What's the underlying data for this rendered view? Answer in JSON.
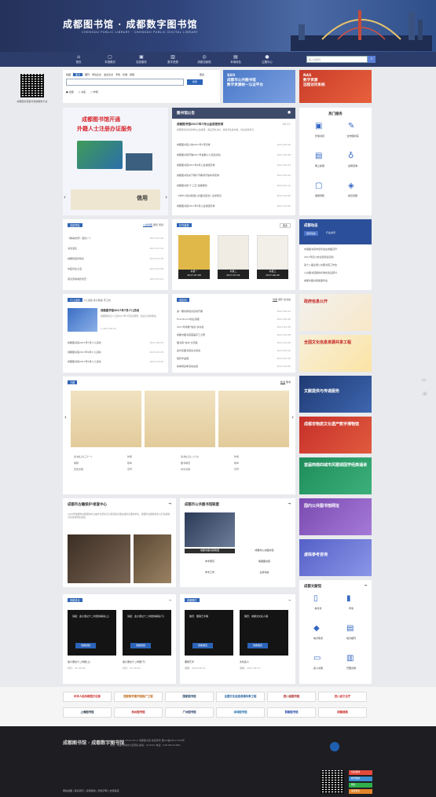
{
  "header": {
    "logo": "成都图书馆 · 成都数字图书馆",
    "logo_sub": "CHENGDU PUBLIC LIBRARY · CHENGDU PUBLIC DIGITAL LIBRARY"
  },
  "nav": [
    {
      "icon": "⌂",
      "label": "首页"
    },
    {
      "icon": "▢",
      "label": "本馆概况"
    },
    {
      "icon": "▣",
      "label": "信息服务"
    },
    {
      "icon": "▥",
      "label": "数字资源"
    },
    {
      "icon": "◎",
      "label": "成都文献馆"
    },
    {
      "icon": "▤",
      "label": "本地特色"
    },
    {
      "icon": "●",
      "label": "主题中心"
    }
  ],
  "search": {
    "placeholder": "输入关键词",
    "button": "搜索"
  },
  "left": {
    "qr_caption": "成都图书馆官方微信服务平台"
  },
  "searchbox": {
    "tabs": [
      "馆藏",
      "图书",
      "期刊",
      "学位论文",
      "会议论文",
      "专利",
      "标准",
      "视频"
    ],
    "tab_active": "图书",
    "more": "更多",
    "options": [
      "全部",
      "书名",
      "作者"
    ],
    "button": "搜索"
  },
  "ads": {
    "sso": "SSO\n成都市公共图书馆\n数字资源统一认证平台",
    "ras": "RAS\n数字资源\n远程访问系统"
  },
  "banner": {
    "line1": "成都图书馆开通",
    "line2": "外籍人士注册办证服务",
    "caption": "信用"
  },
  "notice": {
    "title": "图书馆公告",
    "headline": "成都图书馆2017年7月公益讲座安排",
    "date": "06-21",
    "desc": "成都图书馆每月举办公益讲座，涵盖历史文化、健康养生等内容，欢迎读者参与。",
    "items": [
      [
        "成都图书馆公告2017年7月安排",
        "2017-06-20"
      ],
      [
        "成都图书馆开展2017年暑期少儿阅读活动",
        "2017-05-26"
      ],
      [
        "成都图书馆2017年6月公益讲座安排",
        "2017-05-23"
      ],
      [
        "成都图书馆关于端午节期间开放时间安排",
        "2017-05-22"
      ],
      [
        "成都图书馆\"十三五\"发展规划",
        "2017-05-12"
      ],
      [
        "《中华人民共和国公共图书馆法》征求意见",
        "2017-05-05"
      ],
      [
        "成都图书馆2017年5月公益讲座安排",
        "2017-04-25"
      ]
    ]
  },
  "hot": {
    "title": "热门服务",
    "items": [
      "外借书目",
      "全市图书馆",
      "网上续借",
      "读者咨询",
      "借阅须知",
      "常见问题"
    ]
  },
  "preview": {
    "title": "讲座预告",
    "tabs": [
      "公益讲座",
      "展览",
      "培训"
    ],
    "items": [
      [
        "《聊斋志异》漫谈(一)",
        "2017-07-29"
      ],
      [
        "书法漫谈",
        "2017-07-22"
      ],
      [
        "成都民俗风情谈",
        "2017-07-15"
      ],
      [
        "中医养生之道",
        "2017-07-08"
      ],
      [
        "英文原版电影欣赏",
        "2017-07-01"
      ]
    ]
  },
  "books": {
    "title": "好书推荐",
    "more": "更多",
    "items": [
      {
        "t": "书目一",
        "d": "2017-07-08"
      },
      {
        "t": "书目二",
        "d": "2017-07-01"
      },
      {
        "t": "书目三",
        "d": "2017-06-30"
      }
    ]
  },
  "news": {
    "title": "成都动态",
    "tabs": [
      "馆务动态",
      "行业资讯"
    ],
    "items": [
      "中国图书馆学会年会在成都召开",
      "2017年四川省全民阅读活动",
      "第十八届全国公共图书馆工作会",
      "公共图书馆服务标准化建设研讨",
      "成都市图书馆联盟年会"
    ]
  },
  "kids": {
    "title": "少儿活动",
    "tabs": [
      "少儿活动",
      "亲子阅读",
      "手工坊"
    ],
    "headline": "成都图书馆2017年7月少儿活动",
    "desc": "成都图书馆少儿部2017年7月活动预告，欢迎小读者参加。",
    "date": "2017-06-23",
    "items": [
      [
        "成都图书馆2017年7月少儿活动",
        "2017-06-23"
      ],
      [
        "成都图书馆2017年6月少儿活动",
        "2017-05-25"
      ],
      [
        "成都图书馆2017年5月少儿活动",
        "2017-04-20"
      ]
    ]
  },
  "create": {
    "title": "创空间",
    "tabs": [
      "创客",
      "摄影",
      "读书会"
    ],
    "items": [
      [
        "第一期创客培训活动开展",
        "2017-06-23"
      ],
      [
        "First Round创业讲座",
        "2017-06-20"
      ],
      [
        "2017年成都\"悦读\"读书会",
        "2017-05-30"
      ],
      [
        "成都市图书馆首届手工大赛",
        "2017-05-28"
      ],
      [
        "图书馆\"读书\"交流会",
        "2017-05-20"
      ],
      [
        "金牛区图书馆读书活动",
        "2017-05-15"
      ],
      [
        "摄影作品展",
        "2017-05-10"
      ],
      [
        "春季阅读季活动总结",
        "2017-05-05"
      ]
    ]
  },
  "rightBanners": [
    "政府信息公开",
    "全国文化信息资源共享工程",
    "文献提供与传递服务",
    "成都非物质文化遗产数字博物馆",
    "首届西南四城市风雅颂国学经典诵读",
    "国内公共图书馆网址",
    "虚拟参考咨询"
  ],
  "guji": {
    "title": "古籍",
    "tabs": [
      "新书",
      "借书"
    ],
    "items": [
      [
        "读书札记(三十一)",
        "作者",
        "读书札记(二十九)",
        "作者"
      ],
      [
        "编辑",
        "版本",
        "图书编目",
        "版本"
      ],
      [
        "历史文献",
        "序号",
        "中文文献",
        "序号"
      ]
    ]
  },
  "protect": {
    "title": "成都市古籍保护/修复中心",
    "text": "2016年成都市古籍保护中心被文化部命名为第四批全国古籍重点保护单位，成都市古籍修复中心已具备较为完善的修复设施。",
    "more": "→"
  },
  "alliance": {
    "title": "成都市公共图书馆联盟",
    "more": "→",
    "tabs": [
      "成都市图书馆联盟",
      "成都市公共图书馆"
    ],
    "cells": [
      "学术研究",
      "联盟图书馆",
      "学术工作",
      "业务动态"
    ]
  },
  "localDocs": {
    "title": "成都文献馆",
    "more": "→",
    "items": [
      "地方志",
      "年鉴",
      "地方家谱",
      "地方报刊",
      "名人文献",
      "巴蜀文献"
    ]
  },
  "lecture": {
    "title": "成都讲坛",
    "more": "→",
    "cards": [
      {
        "a": "讲座：金沙遗址十二时辰的解读(上)",
        "btn": "观看视频",
        "cap": "金沙遗址十二时辰(上)",
        "d": "时长：01:44:00"
      },
      {
        "a": "讲座：金沙遗址十二时辰的解读(下)",
        "btn": "观看视频",
        "cap": "金沙遗址十二时辰(下)",
        "d": "时长：01:44:00"
      }
    ]
  },
  "exhibit": {
    "title": "成都展厅",
    "more": "→",
    "cards": [
      {
        "a": "展览：蜀锦艺术展",
        "btn": "观看展览",
        "cap": "蜀锦艺术",
        "d": "展期：2016-06-12"
      },
      {
        "a": "展览：成都文化名人展",
        "btn": "观看展览",
        "cap": "文化名人",
        "d": "展期：2017-04-17"
      }
    ]
  },
  "links": [
    "中华人民共和国文化部",
    "国家数字图书馆推广工程",
    "国家图书馆",
    "全国文化信息资源共享工程",
    "四川省图书馆",
    "四川省文化厅",
    "上海图书馆",
    "杭州图书馆",
    "广州图书馆",
    "深圳图书馆",
    "首都图书馆",
    "成都档案"
  ],
  "footer": {
    "copy": "Copyright © 2014-2017 成都图书馆 版权所有 蜀ICP备05011796号",
    "addr": "地址：成都市锦城大道南段 邮编：610041 电话：028-86121830",
    "links": "网站地图 | 联系我们 | 读者留言 | 隐私声明 | 友情链接",
    "social": [
      "新浪微博",
      "腾讯微博",
      "微信",
      "读者留言"
    ]
  }
}
